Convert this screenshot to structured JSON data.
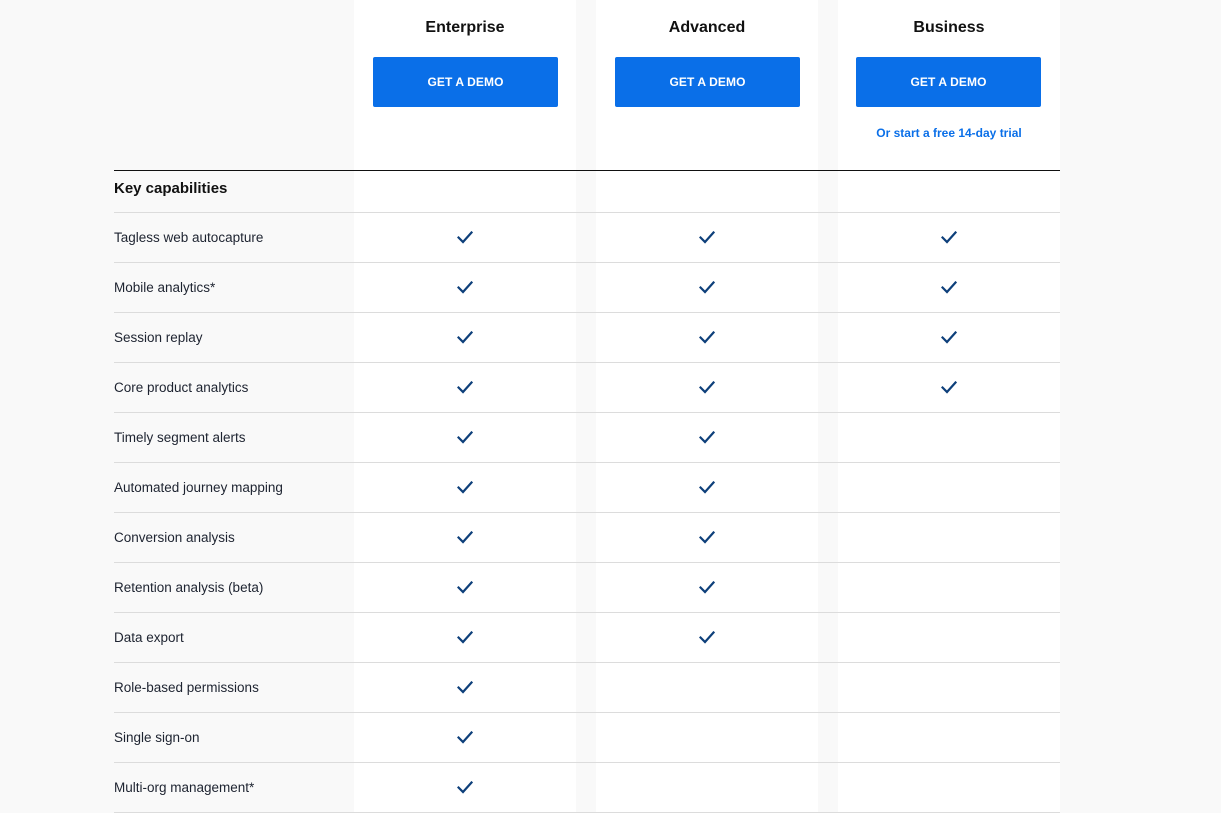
{
  "plans": [
    {
      "name": "Enterprise",
      "cta": "GET A DEMO",
      "trial": ""
    },
    {
      "name": "Advanced",
      "cta": "GET A DEMO",
      "trial": ""
    },
    {
      "name": "Business",
      "cta": "GET A DEMO",
      "trial": "Or start a free 14-day trial"
    }
  ],
  "section": {
    "title": "Key capabilities"
  },
  "icons": {
    "check": "check-icon"
  },
  "colors": {
    "accent": "#0a6fe8",
    "check": "#0d3f7a"
  },
  "rows": [
    {
      "label": "Tagless web autocapture",
      "checks": [
        true,
        true,
        true
      ]
    },
    {
      "label": "Mobile analytics*",
      "checks": [
        true,
        true,
        true
      ]
    },
    {
      "label": "Session replay",
      "checks": [
        true,
        true,
        true
      ]
    },
    {
      "label": "Core product analytics",
      "checks": [
        true,
        true,
        true
      ]
    },
    {
      "label": "Timely segment alerts",
      "checks": [
        true,
        true,
        false
      ]
    },
    {
      "label": "Automated journey mapping",
      "checks": [
        true,
        true,
        false
      ]
    },
    {
      "label": "Conversion analysis",
      "checks": [
        true,
        true,
        false
      ]
    },
    {
      "label": "Retention analysis (beta)",
      "checks": [
        true,
        true,
        false
      ]
    },
    {
      "label": "Data export",
      "checks": [
        true,
        true,
        false
      ]
    },
    {
      "label": "Role-based permissions",
      "checks": [
        true,
        false,
        false
      ]
    },
    {
      "label": "Single sign-on",
      "checks": [
        true,
        false,
        false
      ]
    },
    {
      "label": "Multi-org management*",
      "checks": [
        true,
        false,
        false
      ]
    }
  ]
}
